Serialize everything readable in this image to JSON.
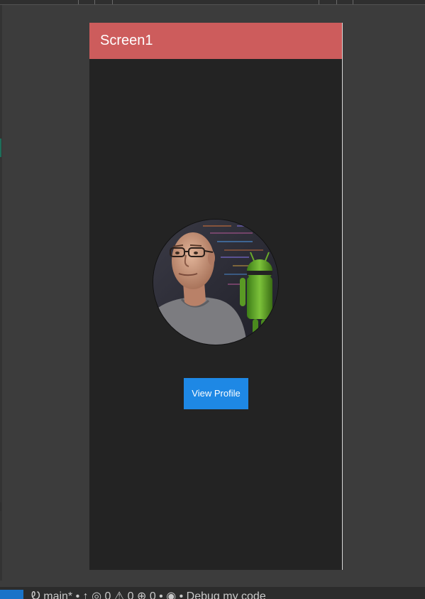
{
  "app_bar": {
    "title": "Screen1",
    "color": "#cd5c5c"
  },
  "profile_image": {
    "icon": "profile-photo",
    "alt": "Profile photo"
  },
  "view_profile_button": {
    "label": "View Profile",
    "color": "#1e88e5"
  },
  "ide_status": {
    "text": "Ꭷ main* • ↑ ◎ 0 ⚠ 0 ⊕ 0 • ◉ • Debug my code"
  },
  "colors": {
    "ide_background": "#3c3c3c",
    "phone_background": "#232323",
    "status_accent": "#1a73c8"
  }
}
